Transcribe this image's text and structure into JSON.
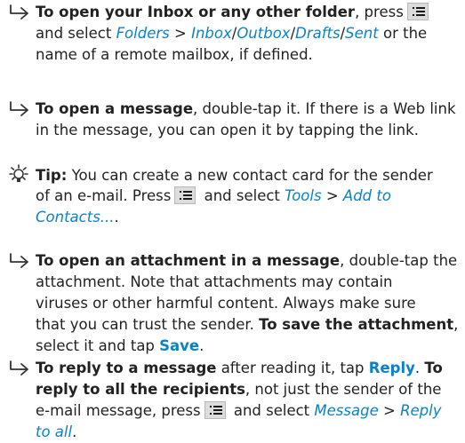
{
  "items": [
    {
      "lines": [
        [
          {
            "t": "b",
            "v": "To open your Inbox or any other folder"
          },
          {
            "t": "n",
            "v": ", press"
          },
          {
            "t": "key"
          }
        ],
        [
          {
            "t": "n",
            "v": "and select "
          },
          {
            "t": "m",
            "v": "Folders"
          },
          {
            "t": "n",
            "v": " > "
          },
          {
            "t": "m",
            "v": "Inbox"
          },
          {
            "t": "n",
            "v": "/"
          },
          {
            "t": "m",
            "v": "Outbox"
          },
          {
            "t": "n",
            "v": "/"
          },
          {
            "t": "m",
            "v": "Drafts"
          },
          {
            "t": "n",
            "v": "/"
          },
          {
            "t": "m",
            "v": "Sent"
          },
          {
            "t": "n",
            "v": " or the"
          }
        ],
        [
          {
            "t": "n",
            "v": "name of a remote mailbox, if defined."
          }
        ]
      ]
    },
    {
      "lines": [
        [
          {
            "t": "b",
            "v": "To open a message"
          },
          {
            "t": "n",
            "v": ", double-tap it. If there is a Web link"
          }
        ],
        [
          {
            "t": "n",
            "v": "in the message, you can open it by tapping the link."
          }
        ]
      ]
    },
    {
      "tip": true,
      "lines": [
        [
          {
            "t": "b",
            "v": "Tip:"
          },
          {
            "t": "n",
            "v": " You can create a new contact card for the sender"
          }
        ],
        [
          {
            "t": "n",
            "v": "of an e-mail. Press"
          },
          {
            "t": "key"
          },
          {
            "t": "n",
            "v": " and select "
          },
          {
            "t": "m",
            "v": "Tools"
          },
          {
            "t": "n",
            "v": " > "
          },
          {
            "t": "m",
            "v": "Add to"
          }
        ],
        [
          {
            "t": "m",
            "v": "Contacts..."
          },
          {
            "t": "n",
            "v": "."
          }
        ]
      ]
    },
    {
      "lines": [
        [
          {
            "t": "b",
            "v": "To open an attachment in a message"
          },
          {
            "t": "n",
            "v": ", double-tap the"
          }
        ],
        [
          {
            "t": "n",
            "v": "attachment. Note that attachments may contain"
          }
        ],
        [
          {
            "t": "n",
            "v": "viruses or other harmful content. Always make sure"
          }
        ],
        [
          {
            "t": "n",
            "v": "that you can trust the sender. "
          },
          {
            "t": "b",
            "v": "To save the attachment"
          },
          {
            "t": "n",
            "v": ","
          }
        ],
        [
          {
            "t": "n",
            "v": "select it and tap "
          },
          {
            "t": "c",
            "v": "Save"
          },
          {
            "t": "n",
            "v": "."
          }
        ]
      ]
    },
    {
      "lines": [
        [
          {
            "t": "b",
            "v": "To reply to a message"
          },
          {
            "t": "n",
            "v": " after reading it, tap "
          },
          {
            "t": "c",
            "v": "Reply"
          },
          {
            "t": "n",
            "v": ". "
          },
          {
            "t": "b",
            "v": "To"
          }
        ],
        [
          {
            "t": "b",
            "v": "reply to all the recipients"
          },
          {
            "t": "n",
            "v": ", not just the sender of the"
          }
        ],
        [
          {
            "t": "n",
            "v": "e-mail message, press"
          },
          {
            "t": "key"
          },
          {
            "t": "n",
            "v": " and select "
          },
          {
            "t": "m",
            "v": "Message"
          },
          {
            "t": "n",
            "v": " > "
          },
          {
            "t": "m",
            "v": "Reply"
          }
        ],
        [
          {
            "t": "m",
            "v": "to all"
          },
          {
            "t": "n",
            "v": "."
          }
        ]
      ]
    }
  ],
  "colors": {
    "menu": "#0a82c8",
    "command": "#0a82c8",
    "text": "#222222"
  },
  "icons": {
    "bullet": "arrow-bullet-icon",
    "tip": "lightbulb-tip-icon",
    "menu_key": "menu-key-icon"
  }
}
